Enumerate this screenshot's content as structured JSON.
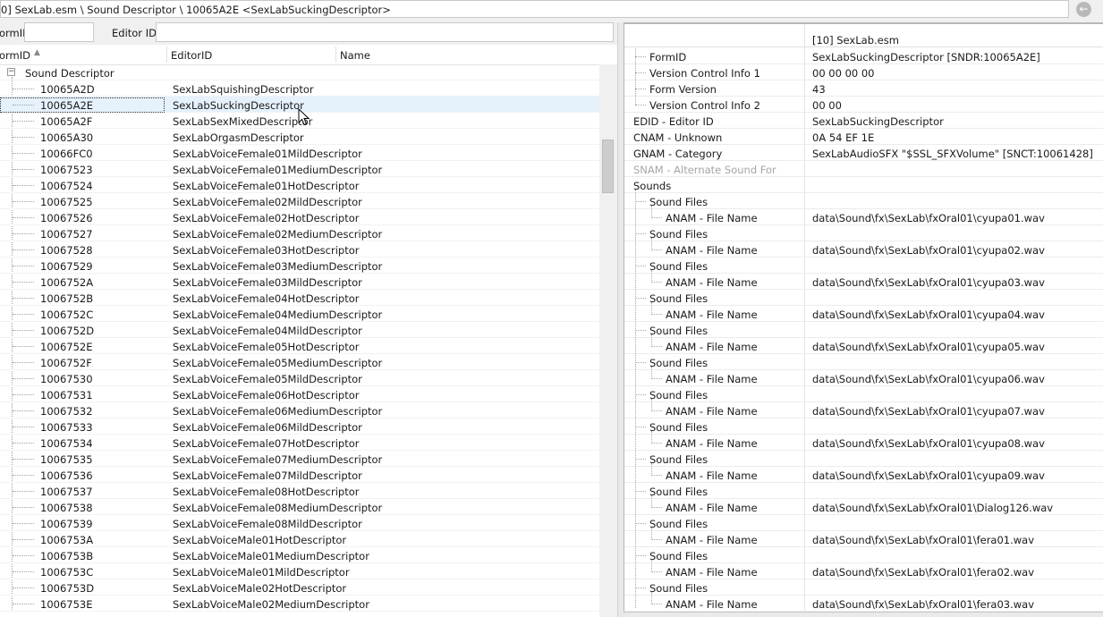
{
  "path": {
    "text": "0] SexLab.esm \\ Sound Descriptor \\ 10065A2E <SexLabSuckingDescriptor>",
    "nav_icon": "back-arrow-icon"
  },
  "filter": {
    "formid_label": "ormID",
    "editorid_label": "Editor ID",
    "formid_value": "",
    "editorid_value": ""
  },
  "left_table": {
    "columns": [
      "ormID",
      "EditorID",
      "Name"
    ],
    "sort_icon": "sort-ascending-icon",
    "group_label": "Sound Descriptor",
    "rows": [
      {
        "formid": "10065A2D",
        "editorid": "SexLabSquishingDescriptor"
      },
      {
        "formid": "10065A2E",
        "editorid": "SexLabSuckingDescriptor"
      },
      {
        "formid": "10065A2F",
        "editorid": "SexLabSexMixedDescriptor"
      },
      {
        "formid": "10065A30",
        "editorid": "SexLabOrgasmDescriptor"
      },
      {
        "formid": "10066FC0",
        "editorid": "SexLabVoiceFemale01MildDescriptor"
      },
      {
        "formid": "10067523",
        "editorid": "SexLabVoiceFemale01MediumDescriptor"
      },
      {
        "formid": "10067524",
        "editorid": "SexLabVoiceFemale01HotDescriptor"
      },
      {
        "formid": "10067525",
        "editorid": "SexLabVoiceFemale02MildDescriptor"
      },
      {
        "formid": "10067526",
        "editorid": "SexLabVoiceFemale02HotDescriptor"
      },
      {
        "formid": "10067527",
        "editorid": "SexLabVoiceFemale02MediumDescriptor"
      },
      {
        "formid": "10067528",
        "editorid": "SexLabVoiceFemale03HotDescriptor"
      },
      {
        "formid": "10067529",
        "editorid": "SexLabVoiceFemale03MediumDescriptor"
      },
      {
        "formid": "1006752A",
        "editorid": "SexLabVoiceFemale03MildDescriptor"
      },
      {
        "formid": "1006752B",
        "editorid": "SexLabVoiceFemale04HotDescriptor"
      },
      {
        "formid": "1006752C",
        "editorid": "SexLabVoiceFemale04MediumDescriptor"
      },
      {
        "formid": "1006752D",
        "editorid": "SexLabVoiceFemale04MildDescriptor"
      },
      {
        "formid": "1006752E",
        "editorid": "SexLabVoiceFemale05HotDescriptor"
      },
      {
        "formid": "1006752F",
        "editorid": "SexLabVoiceFemale05MediumDescriptor"
      },
      {
        "formid": "10067530",
        "editorid": "SexLabVoiceFemale05MildDescriptor"
      },
      {
        "formid": "10067531",
        "editorid": "SexLabVoiceFemale06HotDescriptor"
      },
      {
        "formid": "10067532",
        "editorid": "SexLabVoiceFemale06MediumDescriptor"
      },
      {
        "formid": "10067533",
        "editorid": "SexLabVoiceFemale06MildDescriptor"
      },
      {
        "formid": "10067534",
        "editorid": "SexLabVoiceFemale07HotDescriptor"
      },
      {
        "formid": "10067535",
        "editorid": "SexLabVoiceFemale07MediumDescriptor"
      },
      {
        "formid": "10067536",
        "editorid": "SexLabVoiceFemale07MildDescriptor"
      },
      {
        "formid": "10067537",
        "editorid": "SexLabVoiceFemale08HotDescriptor"
      },
      {
        "formid": "10067538",
        "editorid": "SexLabVoiceFemale08MediumDescriptor"
      },
      {
        "formid": "10067539",
        "editorid": "SexLabVoiceFemale08MildDescriptor"
      },
      {
        "formid": "1006753A",
        "editorid": "SexLabVoiceMale01HotDescriptor"
      },
      {
        "formid": "1006753B",
        "editorid": "SexLabVoiceMale01MediumDescriptor"
      },
      {
        "formid": "1006753C",
        "editorid": "SexLabVoiceMale01MildDescriptor"
      },
      {
        "formid": "1006753D",
        "editorid": "SexLabVoiceMale02HotDescriptor"
      },
      {
        "formid": "1006753E",
        "editorid": "SexLabVoiceMale02MediumDescriptor"
      }
    ],
    "selected_index": 1
  },
  "right_table": {
    "header": "[10] SexLab.esm",
    "rows": [
      {
        "label": "FormID",
        "value": "SexLabSuckingDescriptor [SNDR:10065A2E]",
        "indent": 1
      },
      {
        "label": "Version Control Info 1",
        "value": "00 00 00 00",
        "indent": 1
      },
      {
        "label": "Form Version",
        "value": "43",
        "indent": 1
      },
      {
        "label": "Version Control Info 2",
        "value": "00 00",
        "indent": 1
      },
      {
        "label": "EDID - Editor ID",
        "value": "SexLabSuckingDescriptor",
        "indent": 0
      },
      {
        "label": "CNAM - Unknown",
        "value": "0A 54 EF 1E",
        "indent": 0
      },
      {
        "label": "GNAM - Category",
        "value": "SexLabAudioSFX \"$SSL_SFXVolume\" [SNCT:10061428]",
        "indent": 0
      },
      {
        "label": "SNAM - Alternate Sound For",
        "value": "",
        "indent": 0,
        "disabled": true
      },
      {
        "label": "Sounds",
        "value": "",
        "indent": 0
      },
      {
        "label": "Sound Files",
        "value": "",
        "indent": 1
      },
      {
        "label": "ANAM - File Name",
        "value": "data\\Sound\\fx\\SexLab\\fxOral01\\cyupa01.wav",
        "indent": 2
      },
      {
        "label": "Sound Files",
        "value": "",
        "indent": 1
      },
      {
        "label": "ANAM - File Name",
        "value": "data\\Sound\\fx\\SexLab\\fxOral01\\cyupa02.wav",
        "indent": 2
      },
      {
        "label": "Sound Files",
        "value": "",
        "indent": 1
      },
      {
        "label": "ANAM - File Name",
        "value": "data\\Sound\\fx\\SexLab\\fxOral01\\cyupa03.wav",
        "indent": 2
      },
      {
        "label": "Sound Files",
        "value": "",
        "indent": 1
      },
      {
        "label": "ANAM - File Name",
        "value": "data\\Sound\\fx\\SexLab\\fxOral01\\cyupa04.wav",
        "indent": 2
      },
      {
        "label": "Sound Files",
        "value": "",
        "indent": 1
      },
      {
        "label": "ANAM - File Name",
        "value": "data\\Sound\\fx\\SexLab\\fxOral01\\cyupa05.wav",
        "indent": 2
      },
      {
        "label": "Sound Files",
        "value": "",
        "indent": 1
      },
      {
        "label": "ANAM - File Name",
        "value": "data\\Sound\\fx\\SexLab\\fxOral01\\cyupa06.wav",
        "indent": 2
      },
      {
        "label": "Sound Files",
        "value": "",
        "indent": 1
      },
      {
        "label": "ANAM - File Name",
        "value": "data\\Sound\\fx\\SexLab\\fxOral01\\cyupa07.wav",
        "indent": 2
      },
      {
        "label": "Sound Files",
        "value": "",
        "indent": 1
      },
      {
        "label": "ANAM - File Name",
        "value": "data\\Sound\\fx\\SexLab\\fxOral01\\cyupa08.wav",
        "indent": 2
      },
      {
        "label": "Sound Files",
        "value": "",
        "indent": 1
      },
      {
        "label": "ANAM - File Name",
        "value": "data\\Sound\\fx\\SexLab\\fxOral01\\cyupa09.wav",
        "indent": 2
      },
      {
        "label": "Sound Files",
        "value": "",
        "indent": 1
      },
      {
        "label": "ANAM - File Name",
        "value": "data\\Sound\\fx\\SexLab\\fxOral01\\Dialog126.wav",
        "indent": 2
      },
      {
        "label": "Sound Files",
        "value": "",
        "indent": 1
      },
      {
        "label": "ANAM - File Name",
        "value": "data\\Sound\\fx\\SexLab\\fxOral01\\fera01.wav",
        "indent": 2
      },
      {
        "label": "Sound Files",
        "value": "",
        "indent": 1
      },
      {
        "label": "ANAM - File Name",
        "value": "data\\Sound\\fx\\SexLab\\fxOral01\\fera02.wav",
        "indent": 2
      },
      {
        "label": "Sound Files",
        "value": "",
        "indent": 1
      },
      {
        "label": "ANAM - File Name",
        "value": "data\\Sound\\fx\\SexLab\\fxOral01\\fera03.wav",
        "indent": 2
      }
    ]
  },
  "colors": {
    "selection": "#e5f1fb",
    "disabled_text": "#a6a6a6"
  }
}
